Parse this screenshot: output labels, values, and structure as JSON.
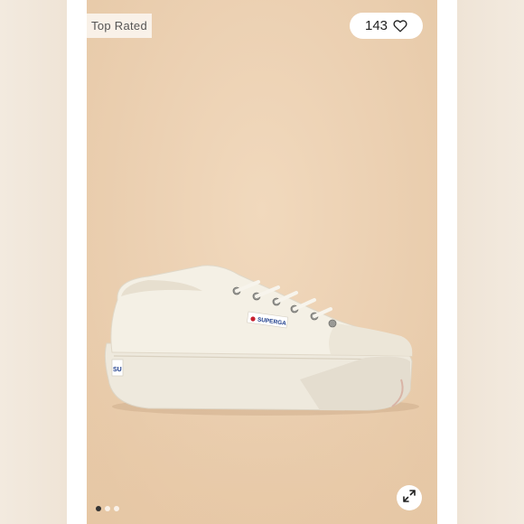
{
  "badge": {
    "label": "Top Rated"
  },
  "favorite": {
    "count": "143",
    "icon": "heart-icon"
  },
  "product": {
    "brand_label": "SUPERGA",
    "heel_label": "SU",
    "image_icon": "sneaker-image"
  },
  "carousel": {
    "total": 3,
    "active_index": 1,
    "dots": [
      "",
      "",
      ""
    ]
  },
  "expand": {
    "icon": "expand-icon"
  },
  "colors": {
    "backdrop": "#ecd1b3",
    "shoe": "#f3efe4",
    "sole": "#f1ede3",
    "logo_red": "#c8202f",
    "logo_blue": "#1a3a8a",
    "dot_active": "#333333",
    "dot_inactive": "#ffffff"
  }
}
